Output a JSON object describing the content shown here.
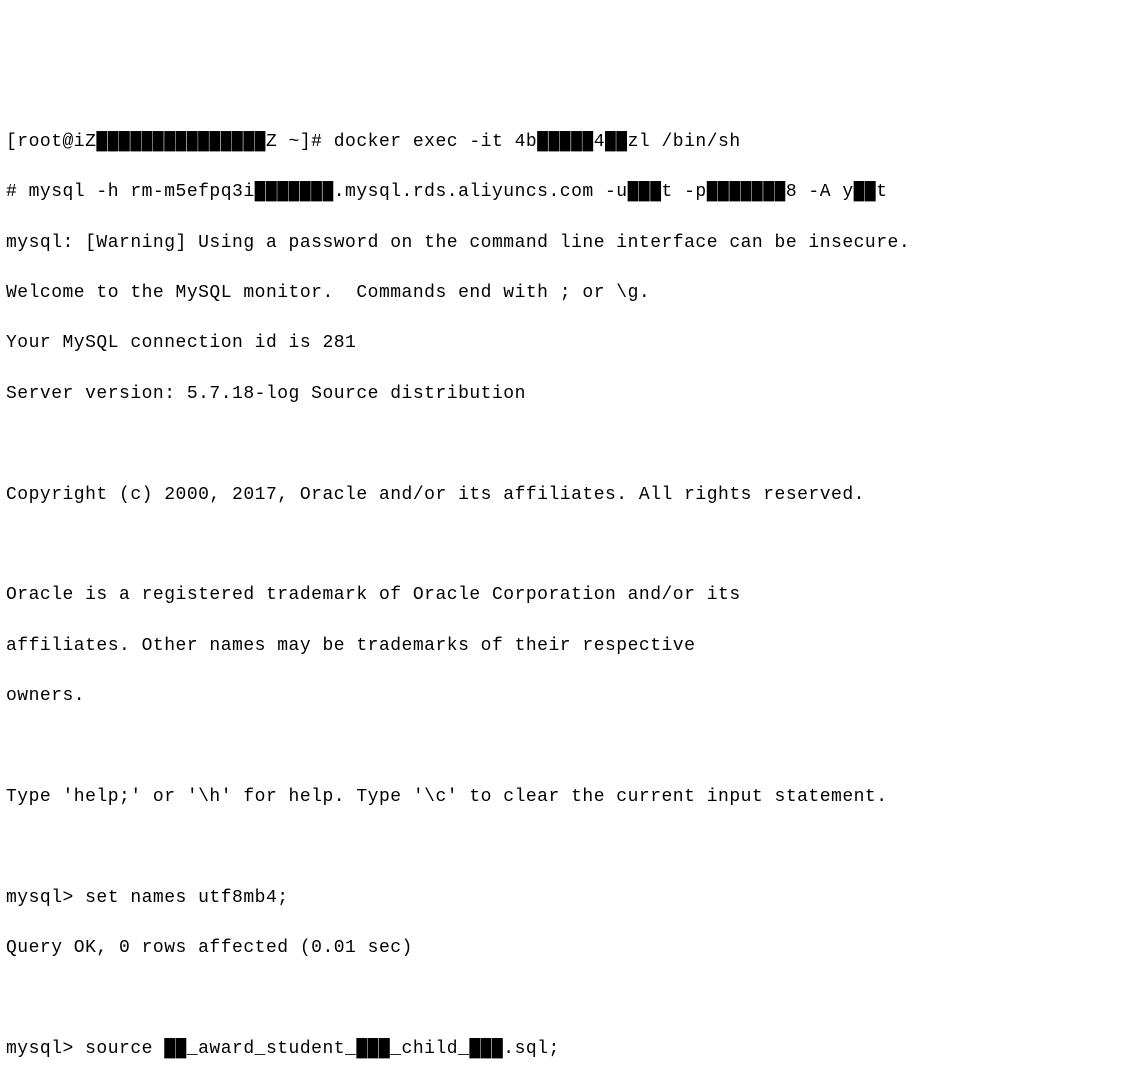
{
  "terminal": {
    "lines": [
      "[root@iZ███████████████Z ~]# docker exec -it 4b█████4██zl /bin/sh",
      "# mysql -h rm-m5efpq3i███████.mysql.rds.aliyuncs.com -u███t -p███████8 -A y██t",
      "mysql: [Warning] Using a password on the command line interface can be insecure.",
      "Welcome to the MySQL monitor.  Commands end with ; or \\g.",
      "Your MySQL connection id is 281",
      "Server version: 5.7.18-log Source distribution",
      "",
      "Copyright (c) 2000, 2017, Oracle and/or its affiliates. All rights reserved.",
      "",
      "Oracle is a registered trademark of Oracle Corporation and/or its",
      "affiliates. Other names may be trademarks of their respective",
      "owners.",
      "",
      "Type 'help;' or '\\h' for help. Type '\\c' to clear the current input statement.",
      "",
      "mysql> set names utf8mb4;",
      "Query OK, 0 rows affected (0.01 sec)",
      "",
      "mysql> source ██_award_student_███_child_███.sql;"
    ]
  }
}
